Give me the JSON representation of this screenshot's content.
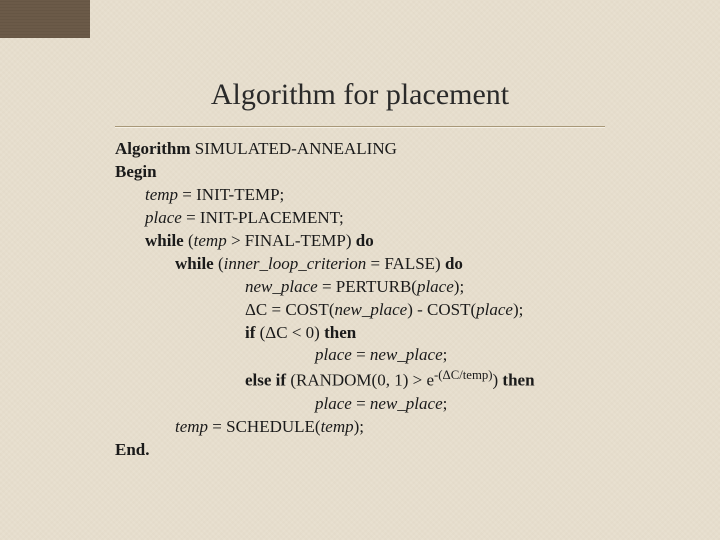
{
  "slide": {
    "title": "Algorithm for placement"
  },
  "algo": {
    "l1a": "Algorithm",
    "l1b": " SIMULATED-ANNEALING",
    "l2": "Begin",
    "l3a": "temp",
    "l3b": " = INIT-TEMP;",
    "l4a": "place",
    "l4b": " = INIT-PLACEMENT;",
    "l5a": "while",
    "l5b": " (",
    "l5c": "temp",
    "l5d": " > FINAL-TEMP) ",
    "l5e": "do",
    "l6a": "while",
    "l6b": " (",
    "l6c": "inner_loop_criterion",
    "l6d": " = FALSE) ",
    "l6e": "do",
    "l7a": "new_place",
    "l7b": " = PERTURB(",
    "l7c": "place",
    "l7d": ");",
    "l8a": "ΔC = COST(",
    "l8b": "new_place",
    "l8c": ")  - COST(",
    "l8d": "place",
    "l8e": ");",
    "l9a": "if",
    "l9b": " (ΔC < 0) ",
    "l9c": "then",
    "l10a": "place",
    "l10b": " = ",
    "l10c": "new_place",
    "l10d": ";",
    "l11a": "else if",
    "l11b": " (RANDOM(0, 1) > e",
    "l11sup": "-(ΔC/temp)",
    "l11c": ") ",
    "l11d": "then",
    "l12a": "place",
    "l12b": " = ",
    "l12c": "new_place",
    "l12d": ";",
    "l13a": "temp",
    "l13b": " = SCHEDULE(",
    "l13c": "temp",
    "l13d": ");",
    "l14": "End."
  }
}
